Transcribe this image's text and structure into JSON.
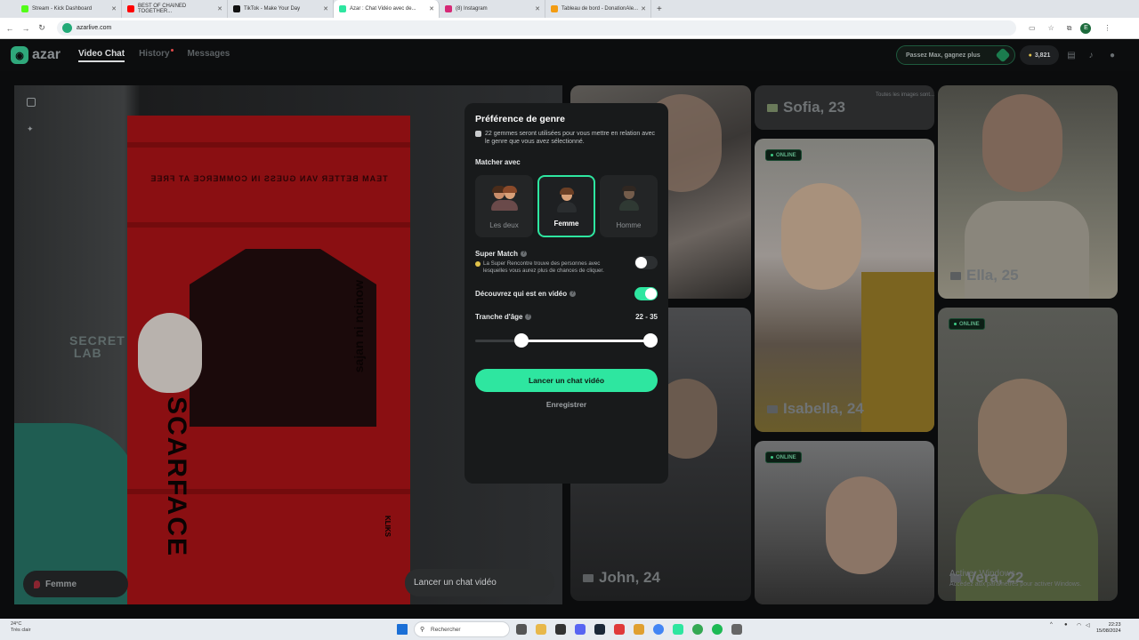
{
  "browser": {
    "tabs": [
      {
        "label": "Stream - Kick Dashboard",
        "color": "#53fc18"
      },
      {
        "label": "BEST OF CHAINED TOGETHER...",
        "color": "#ff0000"
      },
      {
        "label": "TikTok - Make Your Day",
        "color": "#111111"
      },
      {
        "label": "Azar : Chat Vidéo avec de...",
        "color": "#2ee6a0",
        "active": true
      },
      {
        "label": "(8) Instagram",
        "color": "#d62976"
      },
      {
        "label": "Tableau de bord - DonationAle...",
        "color": "#f39c12"
      }
    ],
    "url": "azarlive.com",
    "profile_initial": "E"
  },
  "app": {
    "logo": "azar",
    "nav": {
      "video_chat": "Video Chat",
      "history": "History",
      "messages": "Messages"
    },
    "premium_label": "Passez Max, gagnez plus",
    "coins": "3,821"
  },
  "local": {
    "poster_header": "TEAM BETTER VAN GUESS IN COMMERCE AT FREE",
    "poster_title": "SCARFACE",
    "poster_side": "sajan ni ncinow",
    "poster_tag": "KLIKS",
    "secret_lab": "SECRET\nLAB",
    "gender_pill": "Femme",
    "launch_pill": "Lancer un chat vidéo"
  },
  "grid": {
    "top_right_text": "Toutes les images sont...",
    "people": [
      {
        "name": "Sofia, 23"
      },
      {
        "name": "Ella, 25"
      },
      {
        "name": "Isabella, 24"
      },
      {
        "name": "John, 24"
      },
      {
        "name": "Vera, 22"
      }
    ],
    "online_label": "ONLINE",
    "windows_activation_title": "Activer Windows",
    "windows_activation_sub": "Accédez aux paramètres pour activer Windows."
  },
  "modal": {
    "title": "Préférence de genre",
    "description": "22 gemmes seront utilisées pour vous mettre en relation avec le genre que vous avez sélectionné.",
    "match_with": "Matcher avec",
    "options": [
      {
        "label": "Les deux"
      },
      {
        "label": "Femme",
        "selected": true
      },
      {
        "label": "Homme"
      }
    ],
    "super_match": {
      "title": "Super Match",
      "desc": "La Super Rencontre trouve des personnes avec lesquelles vous aurez plus de chances de cliquer.",
      "enabled": false
    },
    "discover": {
      "title": "Découvrez qui est en vidéo",
      "enabled": true
    },
    "age": {
      "title": "Tranche d'âge",
      "range_label": "22 - 35",
      "min": 22,
      "max": 35
    },
    "cta": "Lancer un chat vidéo",
    "save": "Enregistrer",
    "accent": "#2ee6a0"
  },
  "taskbar": {
    "weather_temp": "24°C",
    "weather_desc": "Très clair",
    "search_placeholder": "Rechercher",
    "time": "22:23",
    "date": "15/08/2024"
  }
}
